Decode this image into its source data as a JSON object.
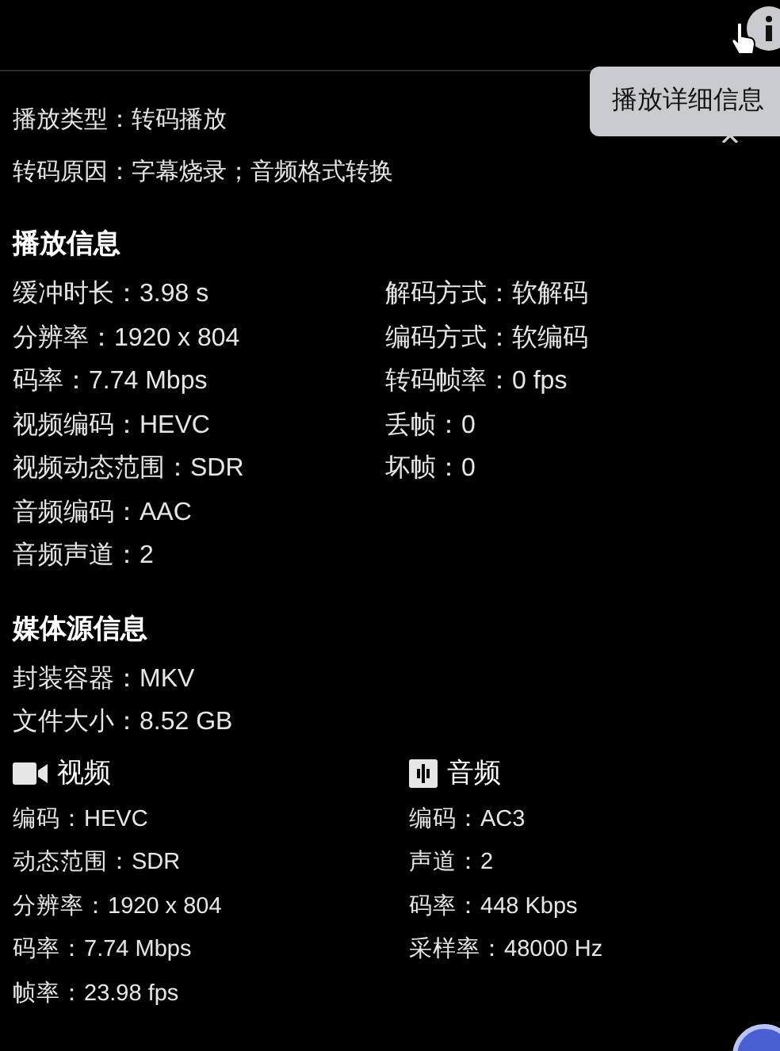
{
  "tooltip": "播放详细信息",
  "summary": [
    "播放类型：转码播放",
    "转码原因：字幕烧录；音频格式转换"
  ],
  "playback": {
    "title": "播放信息",
    "left": [
      "缓冲时长：3.98 s",
      "分辨率：1920 x 804",
      "码率：7.74 Mbps",
      "视频编码：HEVC",
      "视频动态范围：SDR",
      "音频编码：AAC",
      "音频声道：2"
    ],
    "right": [
      "解码方式：软解码",
      "编码方式：软编码",
      "转码帧率：0 fps",
      "丢帧：0",
      "坏帧：0"
    ]
  },
  "media_source": {
    "title": "媒体源信息",
    "items": [
      "封装容器：MKV",
      "文件大小：8.52 GB"
    ],
    "streams": [
      {
        "kind": "video",
        "title": "视频",
        "items": [
          "编码：HEVC",
          "动态范围：SDR",
          "分辨率：1920 x 804",
          "码率：7.74 Mbps",
          "帧率：23.98 fps"
        ]
      },
      {
        "kind": "audio",
        "title": "音频",
        "items": [
          "编码：AC3",
          "声道：2",
          "码率：448 Kbps",
          "采样率：48000 Hz"
        ]
      }
    ]
  }
}
